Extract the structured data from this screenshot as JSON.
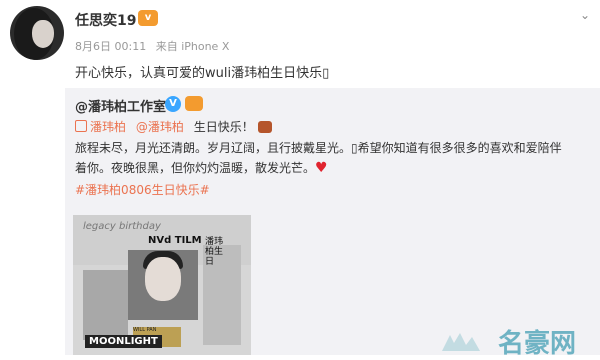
{
  "post": {
    "username": "任思奕19",
    "meta_date": "8月6日 00:11",
    "meta_source": "来自 iPhone X",
    "content": "开心快乐，认真可爱的wuli潘玮柏生日快乐",
    "content_trailing_glyph": "▯"
  },
  "repost": {
    "author": "@潘玮柏工作室",
    "mention_1": "潘玮柏",
    "mention_2": "@潘玮柏",
    "greeting": "生日快乐！",
    "body_line_1": "旅程未尽，月光还清朗。岁月辽阔，且行披戴星光。",
    "body_glyph": "▯",
    "body_line_1b": "希望你知道有很多很多的喜欢和爱陪伴",
    "body_line_2": "着你。夜晚很黑，但你灼灼温暖，散发光芒。",
    "hashtag": "#潘玮柏0806生日快乐#"
  },
  "poster": {
    "name_tag": "NVd TILM",
    "script_text": "legacy birthday",
    "vertical_text": "潘玮柏生日",
    "bottom_text": "MOONLIGHT",
    "ticket_text": "WILL PAN"
  },
  "colors": {
    "accent_orange": "#eb7350",
    "meta_gray": "#999999",
    "verified_blue": "#3aa6ff",
    "heart_red": "#e0242f"
  },
  "watermark": {
    "text": "名豪网"
  }
}
